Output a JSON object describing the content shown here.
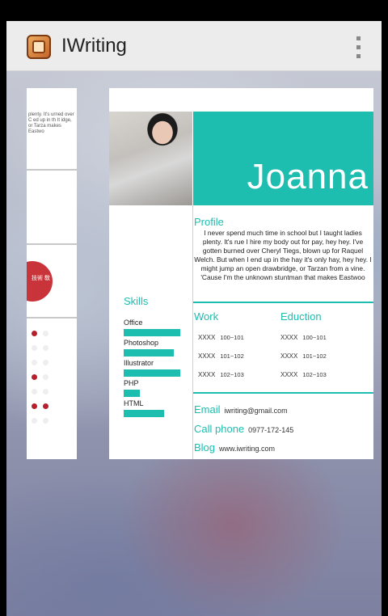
{
  "app": {
    "title": "IWriting"
  },
  "left_card": {
    "text": "plenty. It's urned over C ed up in th It idge, or Tarza makes Eastwo",
    "badge": "技術 敎"
  },
  "resume": {
    "name": "Joanna",
    "profile_title": "Profile",
    "profile_text": "I never spend much time in school but I taught ladies plenty. It's rue I hire my body out for pay, hey hey. I've gotten burned over Cheryl Tiegs, blown up for Raquel Welch. But when I end up in the hay it's only hay, hey hey. I might jump an open drawbridge, or Tarzan from a vine. 'Cause I'm the unknown stuntman that makes Eastwoo",
    "skills_title": "Skills",
    "skills": [
      {
        "label": "Office",
        "level": 0.82
      },
      {
        "label": "Photoshop",
        "level": 0.73
      },
      {
        "label": "Illustrator",
        "level": 0.82
      },
      {
        "label": "PHP",
        "level": 0.24
      },
      {
        "label": "HTML",
        "level": 0.59
      }
    ],
    "work_title": "Work",
    "education_title": "Eduction",
    "work": [
      {
        "name": "XXXX",
        "range": "100~101"
      },
      {
        "name": "XXXX",
        "range": "101~102"
      },
      {
        "name": "XXXX",
        "range": "102~103"
      }
    ],
    "education": [
      {
        "name": "XXXX",
        "range": "100~101"
      },
      {
        "name": "XXXX",
        "range": "101~102"
      },
      {
        "name": "XXXX",
        "range": "102~103"
      }
    ],
    "email_label": "Email",
    "email": "iwriting@gmail.com",
    "phone_label": "Call phone",
    "phone": "0977-172-145",
    "blog_label": "Blog",
    "blog": "www.iwriting.com"
  },
  "colors": {
    "accent": "#1dbdb0",
    "badge": "#c8343a"
  }
}
